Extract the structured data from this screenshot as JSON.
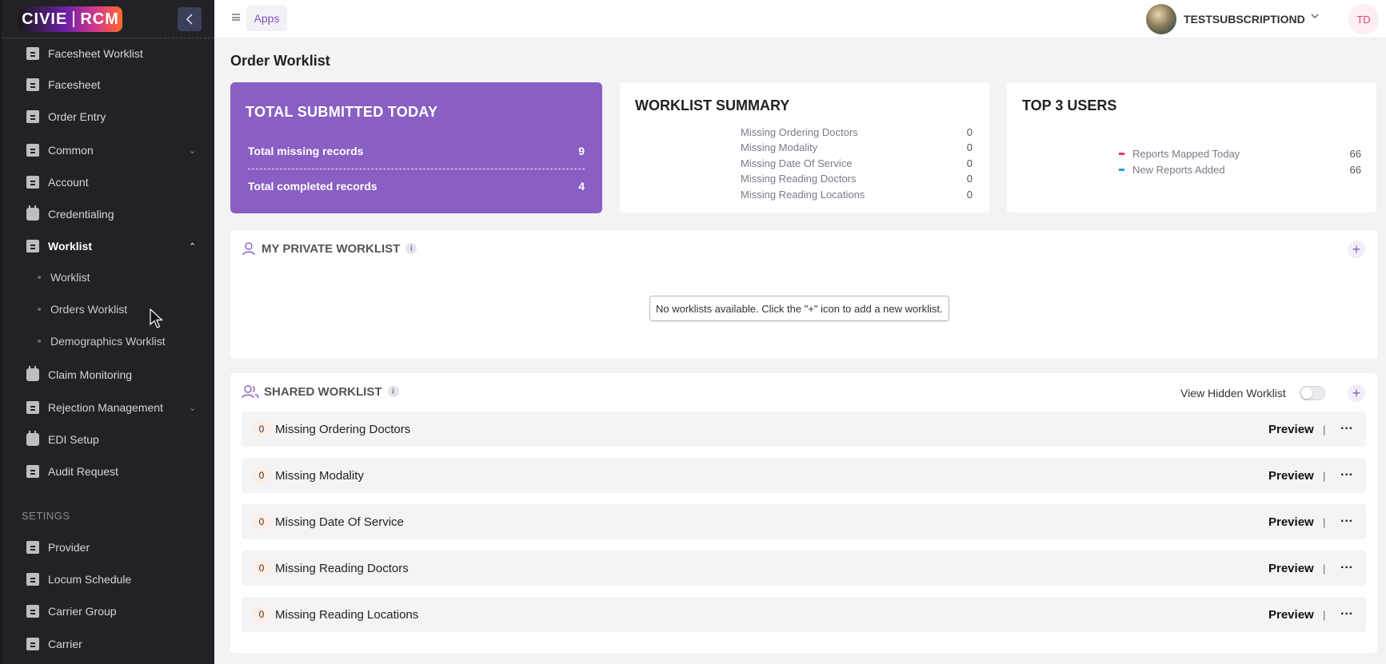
{
  "app": {
    "logo_left": "CIVIE",
    "logo_right": "RCM"
  },
  "sidebar": {
    "items": [
      {
        "label": "Facesheet Worklist",
        "icon": "document-icon"
      },
      {
        "label": "Facesheet",
        "icon": "document-icon"
      },
      {
        "label": "Order Entry",
        "icon": "document-icon"
      },
      {
        "label": "Common",
        "icon": "document-icon",
        "expandable": true
      },
      {
        "label": "Account",
        "icon": "document-icon"
      },
      {
        "label": "Credentialing",
        "icon": "calendar-icon"
      },
      {
        "label": "Worklist",
        "icon": "document-icon",
        "expanded": true
      },
      {
        "label": "Claim Monitoring",
        "icon": "calendar-icon"
      },
      {
        "label": "Rejection Management",
        "icon": "document-icon",
        "expandable": true
      },
      {
        "label": "EDI Setup",
        "icon": "calendar-icon"
      },
      {
        "label": "Audit Request",
        "icon": "document-icon"
      }
    ],
    "worklist_sub": [
      "Worklist",
      "Orders Worklist",
      "Demographics Worklist"
    ],
    "settings_label": "SETINGS",
    "settings_items": [
      {
        "label": "Provider",
        "icon": "document-icon"
      },
      {
        "label": "Locum Schedule",
        "icon": "document-icon"
      },
      {
        "label": "Carrier Group",
        "icon": "document-icon"
      },
      {
        "label": "Carrier",
        "icon": "document-icon"
      }
    ]
  },
  "topbar": {
    "apps_label": "Apps",
    "user_name": "TESTSUBSCRIPTIOND",
    "initials": "TD"
  },
  "page": {
    "title": "Order Worklist"
  },
  "total_card": {
    "title": "TOTAL SUBMITTED TODAY",
    "missing_label": "Total missing records",
    "missing_value": "9",
    "completed_label": "Total completed records",
    "completed_value": "4",
    "color": "#8a5fc4"
  },
  "summary_card": {
    "title": "WORKLIST SUMMARY",
    "rows": [
      {
        "label": "Missing Ordering Doctors",
        "value": "0"
      },
      {
        "label": "Missing Modality",
        "value": "0"
      },
      {
        "label": "Missing Date Of Service",
        "value": "0"
      },
      {
        "label": "Missing Reading Doctors",
        "value": "0"
      },
      {
        "label": "Missing Reading Locations",
        "value": "0"
      }
    ]
  },
  "top3_card": {
    "title": "TOP 3 USERS",
    "legend": [
      {
        "label": "Reports Mapped Today",
        "value": "66",
        "color": "#e8365f"
      },
      {
        "label": "New Reports Added",
        "value": "66",
        "color": "#1e9fe8"
      }
    ]
  },
  "private_worklist": {
    "title": "MY PRIVATE WORKLIST",
    "info": "i",
    "empty_message": "No worklists available. Click the \"+\" icon to add a new worklist."
  },
  "shared_worklist": {
    "title": "SHARED WORKLIST",
    "info": "i",
    "view_hidden_label": "View Hidden Worklist",
    "view_hidden_on": false,
    "preview_label": "Preview",
    "separator": "|",
    "more_label": "···",
    "rows": [
      {
        "count": "0",
        "name": "Missing Ordering Doctors"
      },
      {
        "count": "0",
        "name": "Missing Modality"
      },
      {
        "count": "0",
        "name": "Missing Date Of Service"
      },
      {
        "count": "0",
        "name": "Missing Reading Doctors"
      },
      {
        "count": "0",
        "name": "Missing Reading Locations"
      }
    ]
  },
  "icons": {
    "collapse": "chevron-left-icon",
    "plus": "+",
    "chevron_down": "⌄",
    "chevron_up": "⌃"
  }
}
